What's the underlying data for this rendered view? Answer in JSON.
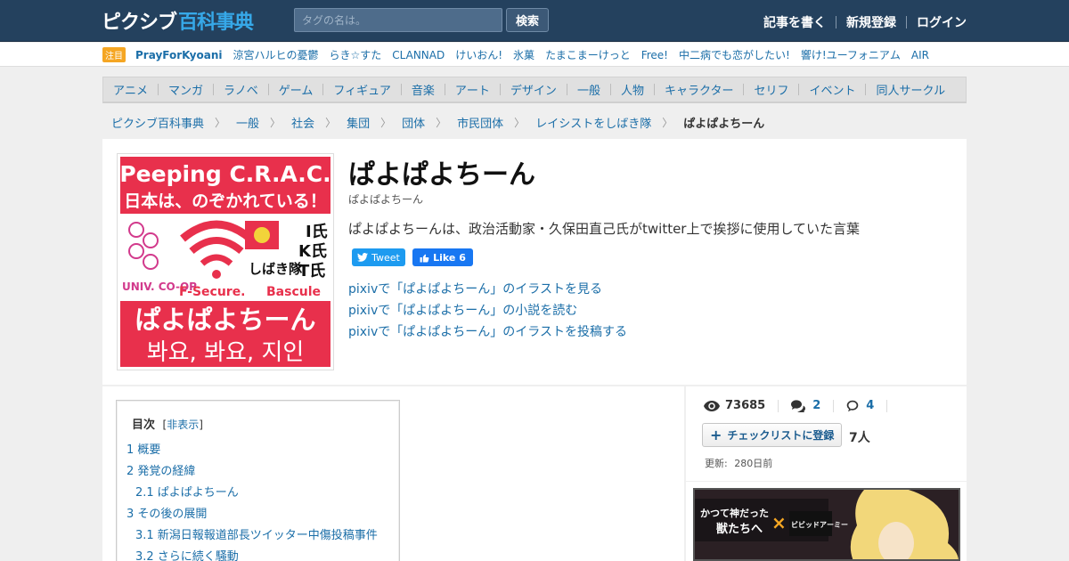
{
  "header": {
    "logo_part1": "ピクシブ",
    "logo_part2": "百科事典",
    "search_placeholder": "タグの名は。",
    "search_button": "検索",
    "links": [
      "記事を書く",
      "新規登録",
      "ログイン"
    ]
  },
  "trending": {
    "badge": "注目",
    "items": [
      "PrayForKyoani",
      "涼宮ハルヒの憂鬱",
      "らき☆すた",
      "CLANNAD",
      "けいおん!",
      "氷菓",
      "たまこまーけっと",
      "Free!",
      "中二病でも恋がしたい!",
      "響け!ユーフォニアム",
      "AIR"
    ]
  },
  "categories": [
    "アニメ",
    "マンガ",
    "ラノベ",
    "ゲーム",
    "フィギュア",
    "音楽",
    "アート",
    "デザイン",
    "一般",
    "人物",
    "キャラクター",
    "セリフ",
    "イベント",
    "同人サークル"
  ],
  "breadcrumb": [
    "ピクシブ百科事典",
    "一般",
    "社会",
    "集団",
    "団体",
    "市民団体",
    "レイシストをしばき隊"
  ],
  "breadcrumb_current": "ぱよぱよちーん",
  "article": {
    "title": "ぱよぱよちーん",
    "reading": "ぱよぱよちーん",
    "summary": "ぱよぱよちーんは、政治活動家・久保田直己氏がtwitter上で挨拶に使用していた言葉",
    "tweet_label": "Tweet",
    "like_label": "Like 6",
    "pixiv_links": [
      "pixivで「ぱよぱよちーん」のイラストを見る",
      "pixivで「ぱよぱよちーん」の小説を読む",
      "pixivで「ぱよぱよちーん」のイラストを投稿する"
    ],
    "thumbnail": {
      "line1": "Peeping C.R.A.C.",
      "line2": "日本は、のぞかれている！",
      "right_lines": [
        "I氏",
        "K氏",
        "T氏"
      ],
      "shibaki": "しばき隊",
      "coop_top": "coop",
      "coop_bottom": "UNIV. CO-OP",
      "fsecure": "F-Secure.",
      "bascule": "Bascule",
      "big_text": "ぱよぱよちーん",
      "korean": "봐요, 봐요, 지인"
    }
  },
  "toc": {
    "title": "目次",
    "hide_open": "[",
    "hide_label": "非表示",
    "hide_close": "]",
    "items": [
      "1 概要",
      "2 発覚の経緯",
      "2.1 ぱよぱよちーん",
      "3 その後の展開",
      "3.1 新潟日報報道部長ツイッター中傷投稿事件",
      "3.2 さらに続く騒動"
    ]
  },
  "sidebar": {
    "views": "73685",
    "comments": "2",
    "bbs": "4",
    "checklist_button": "チェックリストに登録",
    "checklist_count": "7人",
    "updated_label": "更新:",
    "updated_value": "280日前",
    "ad_text1": "かつて神だった",
    "ad_text2": "獣たちへ",
    "ad_text3": "ビビッドアーミー"
  },
  "colors": {
    "header_bg": "#24415e",
    "link": "#1b6ea8",
    "logo_accent": "#36a8e8",
    "thumb_red": "#e8304c"
  }
}
